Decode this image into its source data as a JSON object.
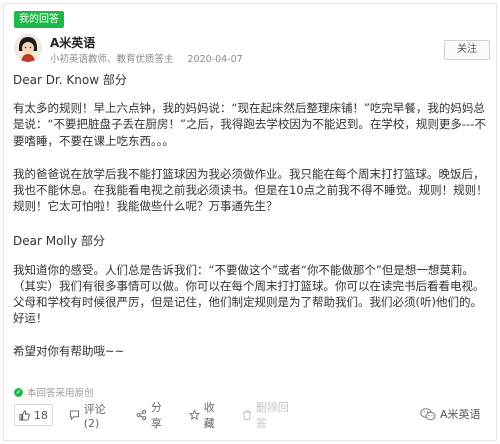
{
  "tag": {
    "label": "我的回答"
  },
  "author": {
    "name": "A米英语",
    "title": "小初英语教师、教育优质答主",
    "date": "2020-04-07"
  },
  "follow_button": {
    "label": "关注"
  },
  "content": {
    "heading_1": "Dear Dr. Know 部分",
    "para_1": "有太多的规则！早上六点钟，我的妈妈说：“现在起床然后整理床铺！”吃完早餐，我的妈妈总是说：“不要把脏盘子丢在厨房！”之后，我得跑去学校因为不能迟到。在学校，规则更多---不要嗜睡，不要在课上吃东西。。。",
    "para_2": "我的爸爸说在放学后我不能打篮球因为我必须做作业。我只能在每个周末打打篮球。晚饭后，我也不能休息。在我能看电视之前我必须读书。但是在10点之前我不得不睡觉。规则！规则！规则！它太可怕啦！我能做些什么呢？万事通先生？",
    "heading_2": "Dear Molly 部分",
    "para_3": "我知道你的感受。人们总是告诉我们：“不要做这个”或者“你不能做那个”但是想一想莫莉。（其实）我们有很多事情可以做。你可以在每个周末打打篮球。你可以在读完书后看看电视。父母和学校有时候很严厉，但是记住，他们制定规则是为了帮助我们。我们必须(听)他们的。好运！",
    "para_4": "希望对你有帮助哦~~"
  },
  "source_note": "本回答采用原创",
  "actions": {
    "like_count": "18",
    "comment": "评论(2)",
    "share": "分享",
    "favorite": "收藏",
    "delete": "删除回答"
  },
  "watermark": "A米英语",
  "icons": {
    "tag": "tag-label",
    "like": "thumbs-up-icon",
    "comment": "comment-icon",
    "share": "share-icon",
    "favorite": "star-icon",
    "delete": "trash-icon",
    "wechat": "wechat-icon",
    "source": "check-icon"
  },
  "colors": {
    "accent": "#21b84a"
  }
}
